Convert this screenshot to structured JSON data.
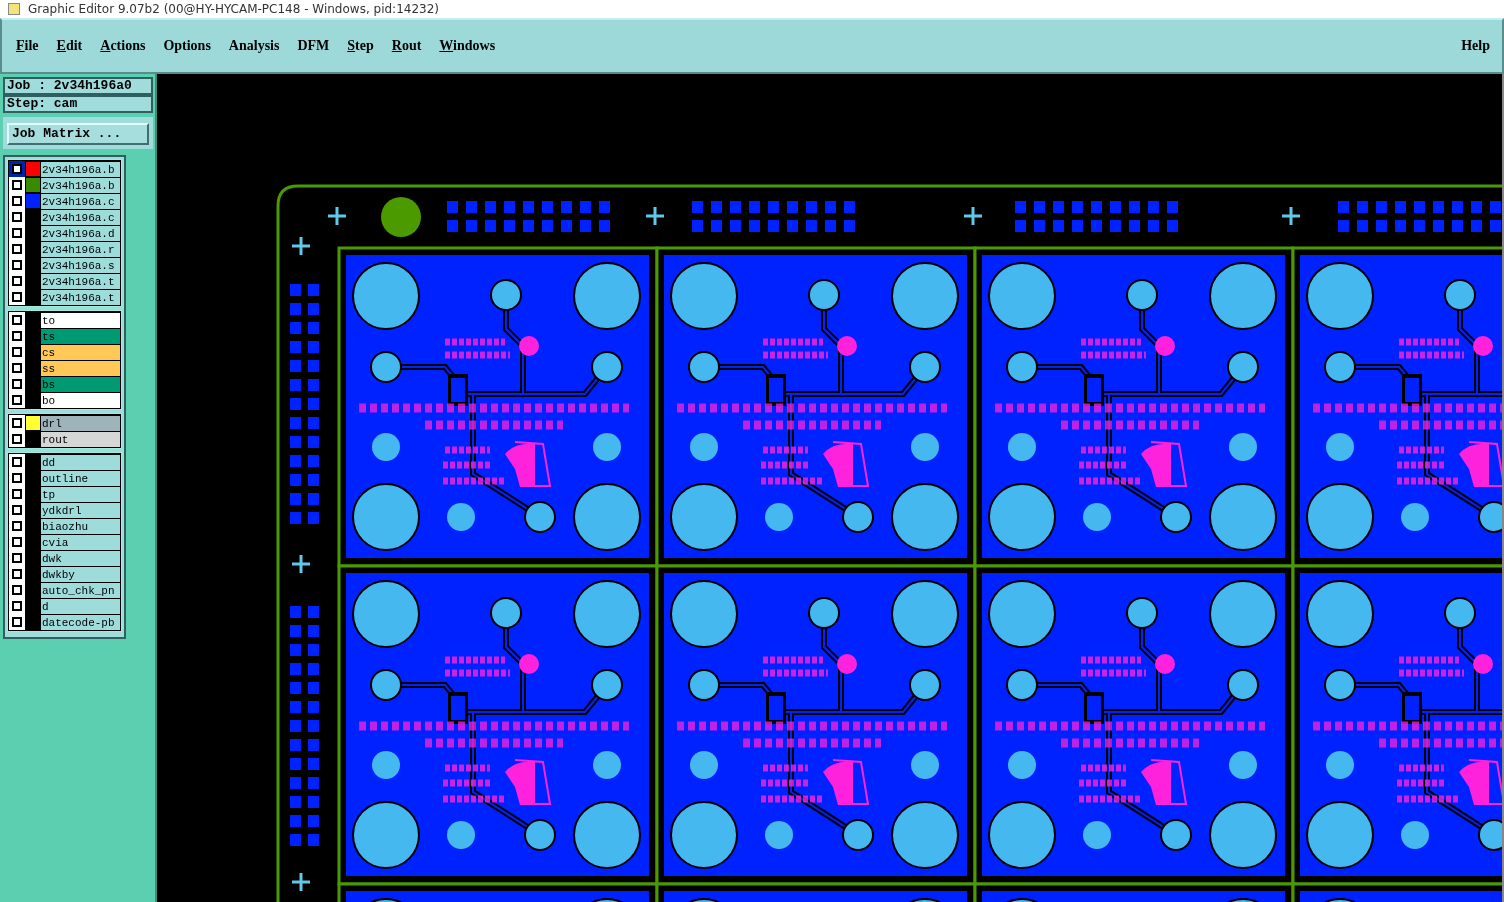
{
  "window": {
    "title": "Graphic Editor 9.07b2 (00@HY-HYCAM-PC148 - Windows, pid:14232)"
  },
  "menu": [
    {
      "label": "File",
      "mnemonic": true
    },
    {
      "label": "Edit",
      "mnemonic": true
    },
    {
      "label": "Actions",
      "mnemonic": true
    },
    {
      "label": "Options",
      "mnemonic": false
    },
    {
      "label": "Analysis",
      "mnemonic": false
    },
    {
      "label": "DFM",
      "mnemonic": false
    },
    {
      "label": "Step",
      "mnemonic": true
    },
    {
      "label": "Rout",
      "mnemonic": true
    },
    {
      "label": "Windows",
      "mnemonic": true
    }
  ],
  "help_menu": {
    "label": "Help",
    "mnemonic": false
  },
  "job_label": "Job : 2v34h196a0",
  "step_label": "Step: cam",
  "job_matrix_button": "Job Matrix ...",
  "layer_groups": [
    {
      "layers": [
        {
          "name": "2v34h196a.b",
          "kind": "misc",
          "selected": true,
          "color": "#ff0000"
        },
        {
          "name": "2v34h196a.b",
          "kind": "misc",
          "selected": false,
          "color": "#3a8a00"
        },
        {
          "name": "2v34h196a.c",
          "kind": "misc",
          "selected": false,
          "color": "#0022ff"
        },
        {
          "name": "2v34h196a.c",
          "kind": "misc",
          "selected": false
        },
        {
          "name": "2v34h196a.d",
          "kind": "misc",
          "selected": false
        },
        {
          "name": "2v34h196a.r",
          "kind": "misc",
          "selected": false
        },
        {
          "name": "2v34h196a.s",
          "kind": "misc",
          "selected": false
        },
        {
          "name": "2v34h196a.t",
          "kind": "misc",
          "selected": false
        },
        {
          "name": "2v34h196a.t",
          "kind": "misc",
          "selected": false
        }
      ]
    },
    {
      "layers": [
        {
          "name": "to",
          "kind": "silk_screen",
          "selected": false
        },
        {
          "name": "ts",
          "kind": "solder_mask",
          "selected": false
        },
        {
          "name": "cs",
          "kind": "signal",
          "selected": false
        },
        {
          "name": "ss",
          "kind": "signal",
          "selected": false
        },
        {
          "name": "bs",
          "kind": "solder_mask",
          "selected": false
        },
        {
          "name": "bo",
          "kind": "silk_screen",
          "selected": false
        }
      ]
    },
    {
      "layers": [
        {
          "name": "drl",
          "kind": "drill",
          "selected": false,
          "color": "#ffff33"
        },
        {
          "name": "rout",
          "kind": "rout",
          "selected": false
        }
      ]
    },
    {
      "layers": [
        {
          "name": "dd",
          "kind": "misc",
          "selected": false
        },
        {
          "name": "outline",
          "kind": "misc",
          "selected": false
        },
        {
          "name": "tp",
          "kind": "misc",
          "selected": false
        },
        {
          "name": "ydkdrl",
          "kind": "misc",
          "selected": false
        },
        {
          "name": "biaozhu",
          "kind": "misc",
          "selected": false
        },
        {
          "name": "cvia",
          "kind": "misc",
          "selected": false
        },
        {
          "name": "dwk",
          "kind": "misc",
          "selected": false
        },
        {
          "name": "dwkby",
          "kind": "misc",
          "selected": false
        },
        {
          "name": "auto_chk_pn",
          "kind": "misc",
          "selected": false
        },
        {
          "name": "d",
          "kind": "misc",
          "selected": false
        },
        {
          "name": "datecode-pb",
          "kind": "misc",
          "selected": false
        }
      ]
    }
  ]
}
